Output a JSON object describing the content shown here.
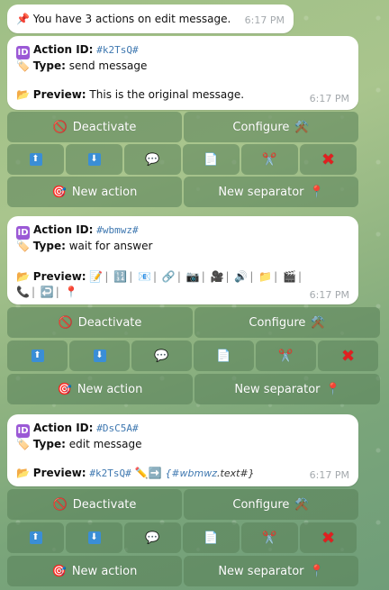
{
  "header": {
    "text": "You have 3 actions on edit message.",
    "time": "6:17 PM",
    "pin_icon": "📌"
  },
  "labels": {
    "action_id": "Action ID:",
    "type": "Type:",
    "preview": "Preview:"
  },
  "icons": {
    "id": "ID",
    "tag": "🏷️",
    "folder": "📂"
  },
  "actions": [
    {
      "id": "#k2TsQ#",
      "type": "send message",
      "preview": "This is the original message.",
      "time": "6:17 PM"
    },
    {
      "id": "#wbmwz#",
      "type": "wait for answer",
      "time": "6:17 PM",
      "preview_icons": [
        "📝",
        "🔢",
        "📧",
        "🔗",
        "📷",
        "🎥",
        "🔊",
        "📁",
        "🎬",
        "📞",
        "↩️",
        "📍"
      ]
    },
    {
      "id": "#DsC5A#",
      "type": "edit message",
      "time": "6:17 PM",
      "preview_ref": "#k2TsQ#",
      "preview_arrow": "✏️➡️",
      "preview_expr_pre": "{",
      "preview_expr_ref": "#wbmwz",
      "preview_expr_post": ".text#}"
    }
  ],
  "keyboard": {
    "deactivate": "Deactivate",
    "configure": "Configure",
    "new_action": "New action",
    "new_separator": "New separator",
    "deactivate_icon": "🚫",
    "configure_icon": "⚒️",
    "new_action_icon": "🎯",
    "new_separator_icon": "📍",
    "up_icon": "⬆",
    "down_icon": "⬇",
    "comment_icon": "💬",
    "doc_icon": "📄",
    "cut_icon": "✂️",
    "delete_icon": "✖"
  }
}
